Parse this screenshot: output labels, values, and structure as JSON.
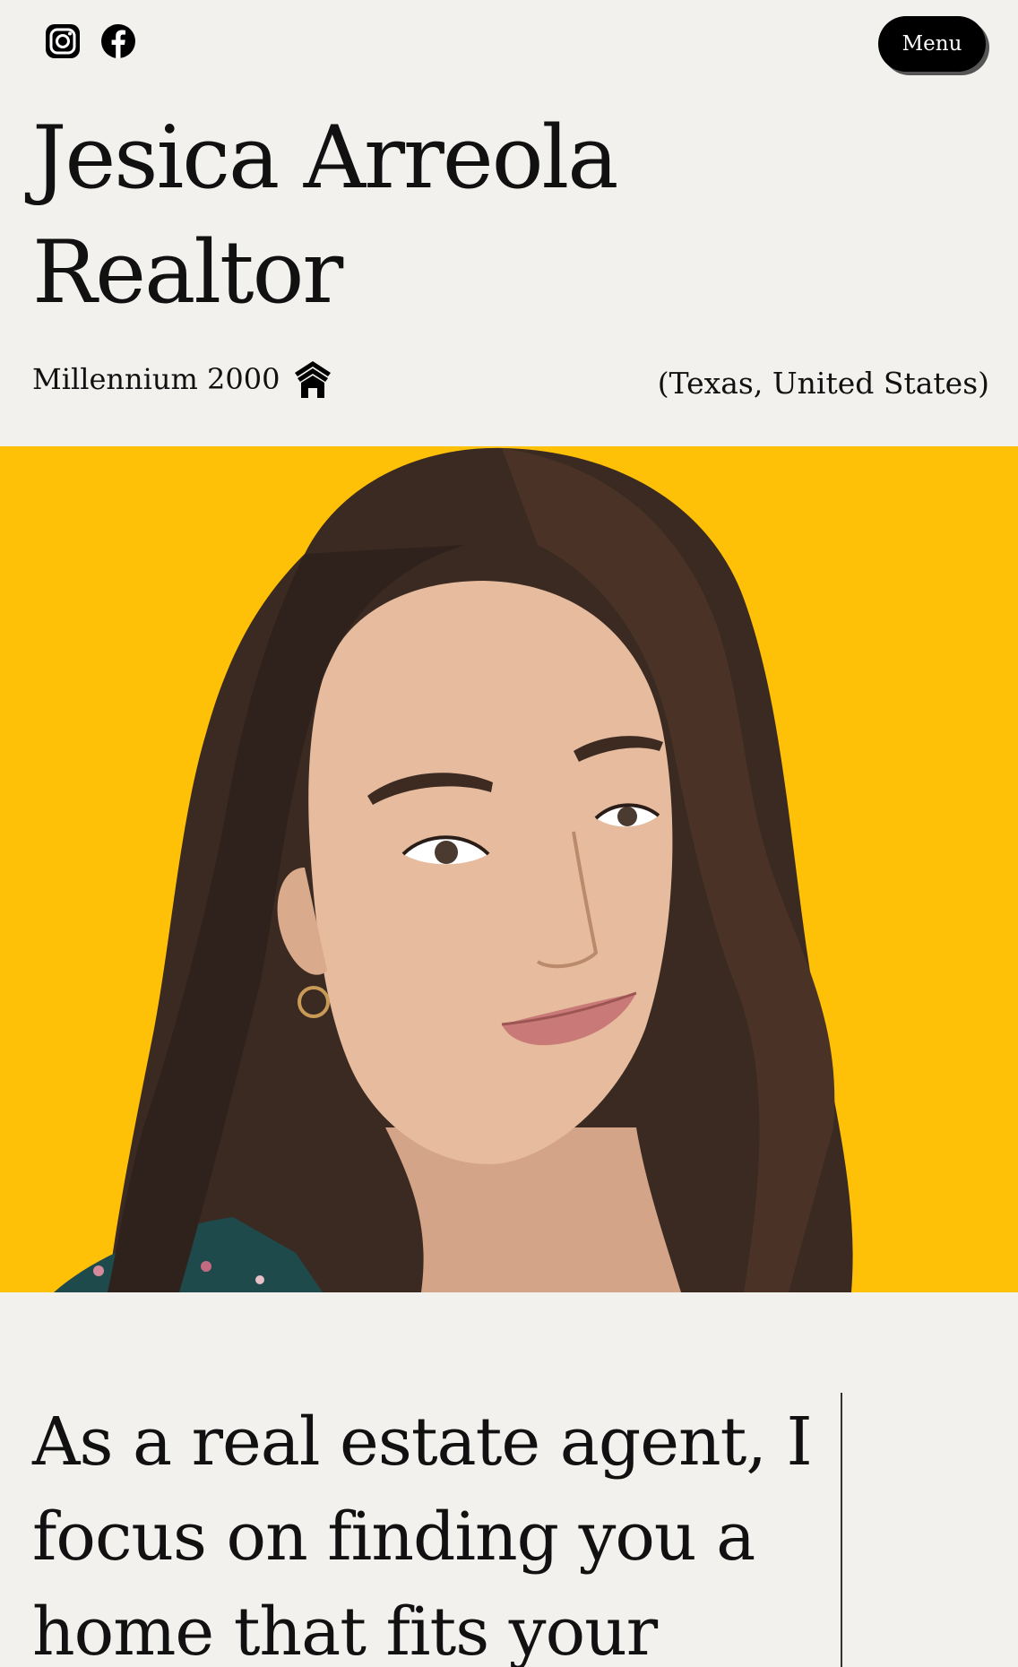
{
  "header": {
    "social": [
      {
        "icon": "instagram-icon"
      },
      {
        "icon": "facebook-icon"
      }
    ],
    "menu_label": "Menu"
  },
  "title": {
    "line1": "Jesica Arreola",
    "line2": "Realtor"
  },
  "brokerage": {
    "name": "Millennium 2000",
    "icon": "house-icon"
  },
  "location": "(Texas, United States)",
  "hero": {
    "background_color": "#ffc107"
  },
  "statement": "As a real estate agent, I focus on finding you a home that fits your"
}
